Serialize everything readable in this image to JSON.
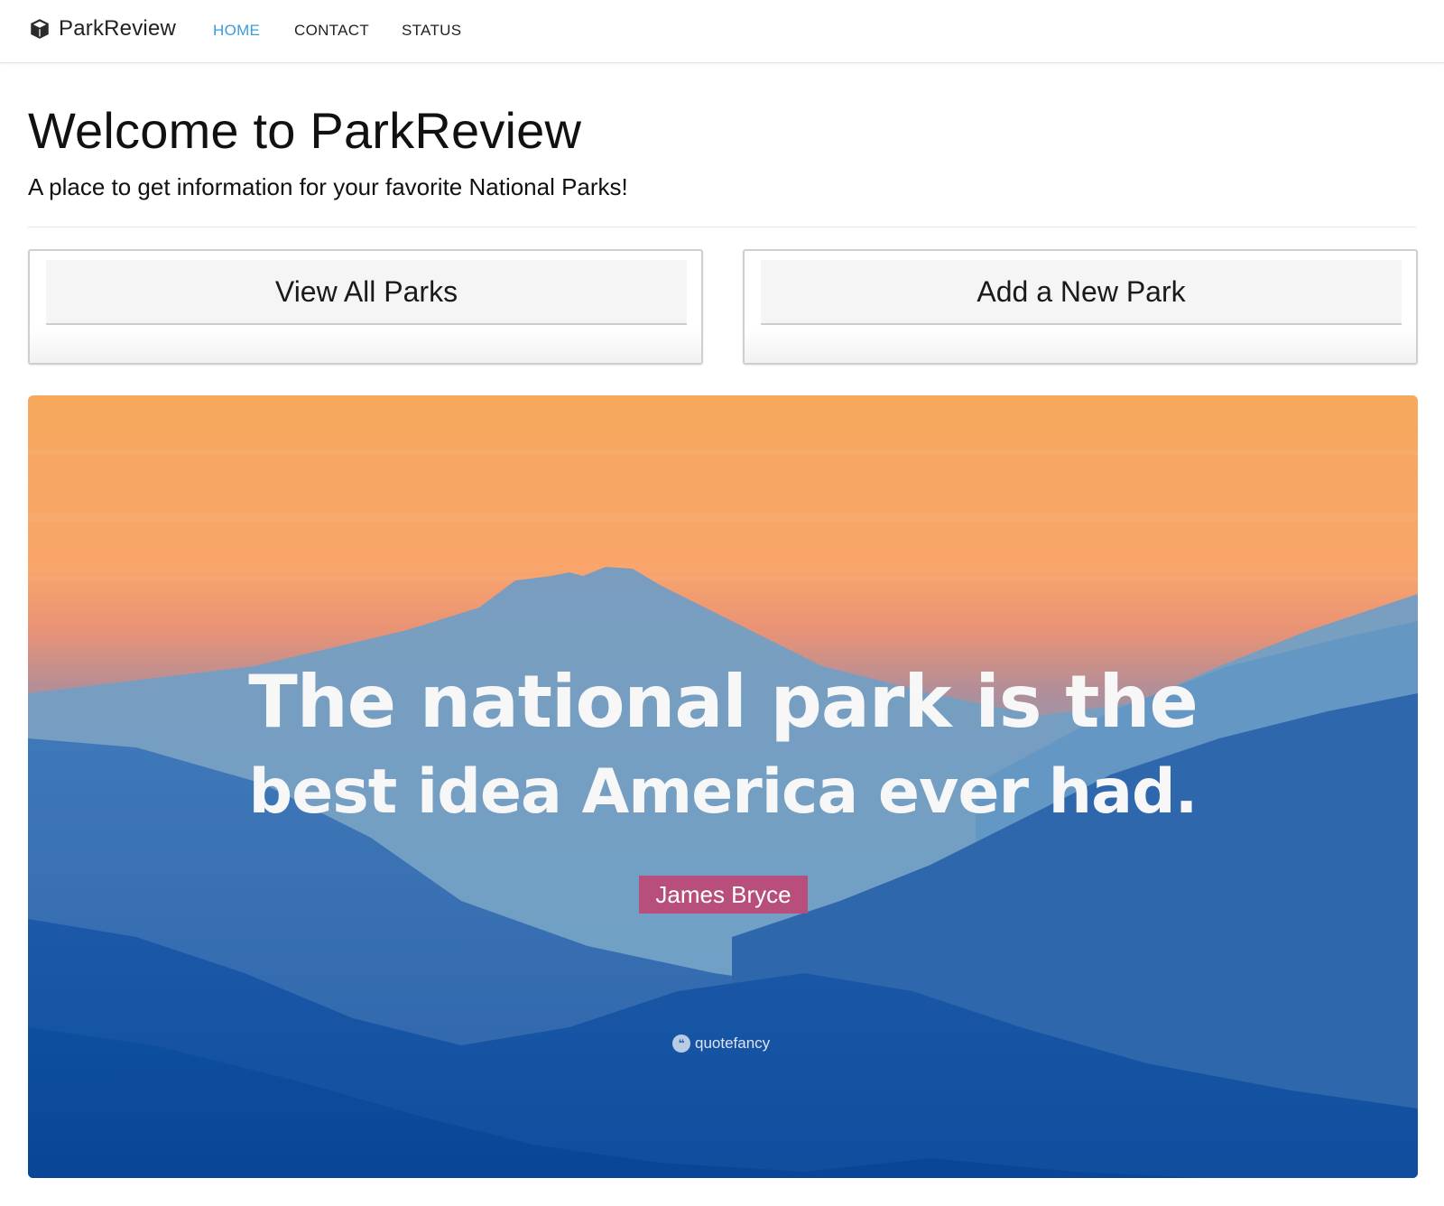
{
  "navbar": {
    "brand": "ParkReview",
    "brand_icon": "cube-icon",
    "links": [
      {
        "label": "HOME",
        "active": true
      },
      {
        "label": "CONTACT",
        "active": false
      },
      {
        "label": "STATUS",
        "active": false
      }
    ],
    "active_color": "#3a9be0"
  },
  "header": {
    "title": "Welcome to ParkReview",
    "subtitle": "A place to get information for your favorite National Parks!"
  },
  "cards": [
    {
      "label": "View All Parks"
    },
    {
      "label": "Add a New Park"
    }
  ],
  "hero": {
    "quote_line1": "The national park is the",
    "quote_line2": "best idea America ever had.",
    "author": "James Bryce",
    "watermark": "quotefancy",
    "author_badge_color": "#b74e7c"
  }
}
